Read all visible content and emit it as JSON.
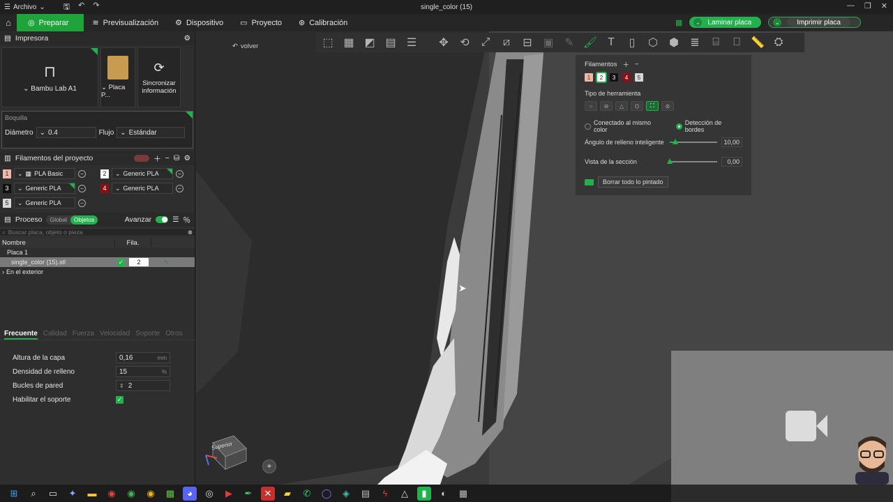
{
  "titlebar": {
    "menu_label": "Archivo",
    "window_title": "single_color (15)"
  },
  "nav": {
    "tabs": [
      {
        "label": "Preparar",
        "active": true
      },
      {
        "label": "Previsualización",
        "active": false
      },
      {
        "label": "Dispositivo",
        "active": false
      },
      {
        "label": "Proyecto",
        "active": false
      },
      {
        "label": "Calibración",
        "active": false
      }
    ],
    "slice_button": "Laminar placa",
    "print_button": "Imprimir placa"
  },
  "printer": {
    "section_title": "Impresora",
    "printer_name": "Bambu Lab A1",
    "plate_name": "Placa P...",
    "sync_label_1": "Sincronizar",
    "sync_label_2": "información"
  },
  "nozzle": {
    "title": "Boquilla",
    "diameter_label": "Diámetro",
    "diameter_value": "0.4",
    "flow_label": "Flujo",
    "flow_value": "Estándar"
  },
  "filaments": {
    "section_title": "Filamentos del proyecto",
    "items": [
      {
        "num": "1",
        "name": "PLA Basic",
        "color": "#f0b6a8",
        "text_color": "#333333"
      },
      {
        "num": "2",
        "name": "Generic PLA",
        "color": "#ffffff",
        "text_color": "#222222"
      },
      {
        "num": "3",
        "name": "Generic PLA",
        "color": "#111111",
        "text_color": "#ffffff"
      },
      {
        "num": "4",
        "name": "Generic PLA",
        "color": "#8b0f14",
        "text_color": "#ffffff"
      },
      {
        "num": "5",
        "name": "Generic PLA",
        "color": "#d8d8d8",
        "text_color": "#222222"
      }
    ]
  },
  "process": {
    "section_title": "Proceso",
    "global_label": "Global",
    "objects_label": "Objetos",
    "advance_label": "Avanzar",
    "search_placeholder": "Buscar placa, objeto o pieza",
    "col_name": "Nombre",
    "col_fila": "Fila.",
    "plate_row": "Placa 1",
    "object_row": "single_color (15).stl",
    "object_fila": "2",
    "outside_row": "En el exterior"
  },
  "settings_tabs": [
    "Frecuente",
    "Calidad",
    "Fuerza",
    "Velocidad",
    "Soporte",
    "Otros"
  ],
  "settings": {
    "layer_height_label": "Altura de la capa",
    "layer_height_value": "0,16",
    "layer_height_unit": "mm",
    "infill_label": "Densidad de relleno",
    "infill_value": "15",
    "infill_unit": "%",
    "walls_label": "Bucles de pared",
    "walls_value": "2",
    "support_label": "Habilitar el soporte",
    "support_enabled": true
  },
  "viewport": {
    "back_label": "volver",
    "cube_label": "Superior"
  },
  "paint_panel": {
    "filaments_label": "Filamentos",
    "chips": [
      {
        "num": "1",
        "color": "#f0b6a8",
        "text_color": "#333333"
      },
      {
        "num": "2",
        "color": "#ffffff",
        "text_color": "#222222"
      },
      {
        "num": "3",
        "color": "#111111",
        "text_color": "#ffffff"
      },
      {
        "num": "4",
        "color": "#8b0f14",
        "text_color": "#ffffff"
      },
      {
        "num": "5",
        "color": "#d8d8d8",
        "text_color": "#222222"
      }
    ],
    "tool_type_label": "Tipo de herramienta",
    "radio_same_color": "Conectado al mismo color",
    "radio_edge_detect": "Detección de bordes",
    "smart_fill_label": "Ángulo de relleno inteligente",
    "smart_fill_value": "10,00",
    "smart_fill_fraction": 0.12,
    "section_view_label": "Vista de la sección",
    "section_view_value": "0,00",
    "section_view_fraction": 0.0,
    "clear_label": "Borrar todo lo pintado"
  },
  "colors": {
    "accent": "#22b14c"
  }
}
